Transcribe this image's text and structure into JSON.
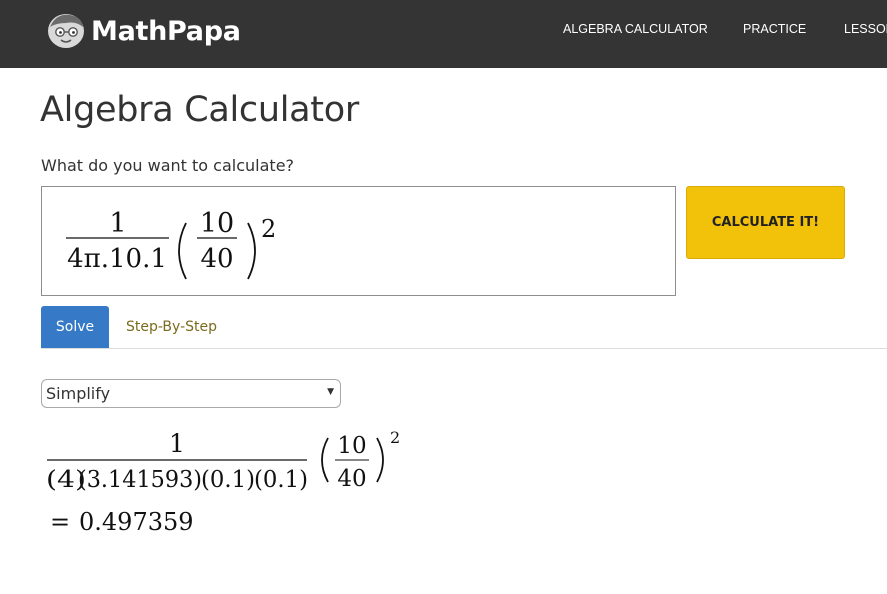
{
  "brand": {
    "name": "MathPapa",
    "logo_icon": "mathpapa-face-logo-icon"
  },
  "nav": {
    "items": [
      {
        "label": "ALGEBRA CALCULATOR"
      },
      {
        "label": "PRACTICE"
      },
      {
        "label": "LESSON"
      }
    ]
  },
  "page": {
    "title": "Algebra Calculator",
    "prompt": "What do you want to calculate?"
  },
  "input": {
    "frac_num": "1",
    "frac_den": "4π.10.1",
    "paren_num": "10",
    "paren_den": "40",
    "exponent": "2"
  },
  "calculate_button": {
    "label": "CALCULATE IT!"
  },
  "tabs": {
    "solve": "Solve",
    "step_by_step": "Step-By-Step"
  },
  "mode_select": {
    "selected": "Simplify"
  },
  "result": {
    "frac_num": "1",
    "den_parts": [
      "(4)",
      "(3.141593)",
      "(0.1)",
      "(0.1)"
    ],
    "paren_num": "10",
    "paren_den": "40",
    "exponent": "2",
    "answer_symbol": "=",
    "answer_value": "0.497359"
  },
  "colors": {
    "navbar": "#343434",
    "accent_button": "#f2c10a",
    "active_tab": "#3679c6",
    "inactive_tab_text": "#7a6a1c"
  }
}
